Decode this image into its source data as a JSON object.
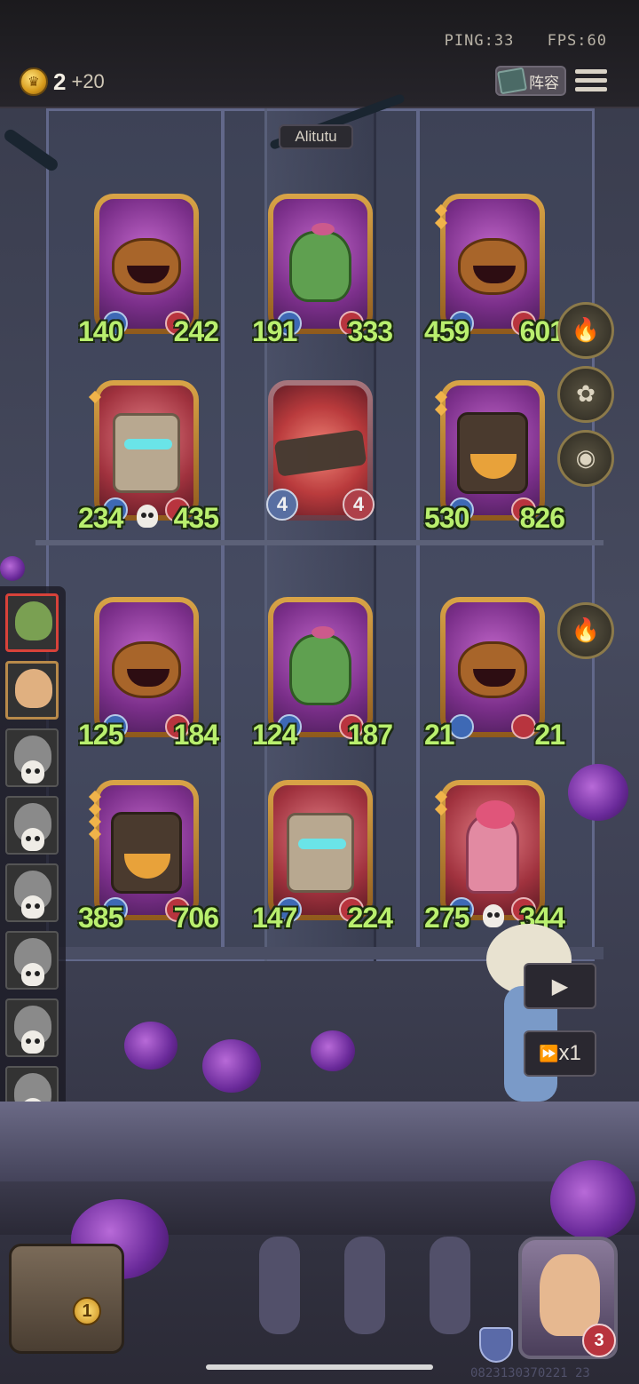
{
  "status": {
    "ping": "PING:33",
    "fps": "FPS:60"
  },
  "gold": {
    "amount": "2",
    "income": "+20"
  },
  "header": {
    "lineup_label": "阵容"
  },
  "opponent": {
    "name": "Alitutu"
  },
  "cards": [
    {
      "monster": "pumpkin",
      "atk": "140",
      "hp": "242",
      "stars": 0
    },
    {
      "monster": "cactus",
      "atk": "191",
      "hp": "333",
      "stars": 0
    },
    {
      "monster": "pumpkin",
      "atk": "459",
      "hp": "601",
      "stars": 2
    },
    {
      "monster": "tree",
      "atk": "234",
      "hp": "435",
      "stars": 1,
      "skull": true
    },
    {
      "monster": "ghost-cactus",
      "atk": "4",
      "hp": "4",
      "stars": 0,
      "ghost": true
    },
    {
      "monster": "stump",
      "atk": "530",
      "hp": "826",
      "stars": 2
    },
    {
      "monster": "pumpkin",
      "atk": "125",
      "hp": "184",
      "stars": 0
    },
    {
      "monster": "cactus",
      "atk": "124",
      "hp": "187",
      "stars": 0
    },
    {
      "monster": "pumpkin",
      "atk": "21",
      "hp": "21",
      "stars": 0
    },
    {
      "monster": "stump",
      "atk": "385",
      "hp": "706",
      "stars": 4
    },
    {
      "monster": "tree",
      "atk": "147",
      "hp": "224",
      "stars": 0
    },
    {
      "monster": "lady",
      "atk": "275",
      "hp": "344",
      "stars": 2,
      "skull": true
    }
  ],
  "items": [
    {
      "icon": "lighter-icon"
    },
    {
      "icon": "rose-icon"
    },
    {
      "icon": "crystal-orb-icon"
    },
    {
      "icon": "lighter-icon"
    }
  ],
  "roster": [
    {
      "state": "active"
    },
    {
      "state": "alive"
    },
    {
      "state": "dead"
    },
    {
      "state": "dead"
    },
    {
      "state": "dead"
    },
    {
      "state": "dead"
    },
    {
      "state": "dead"
    },
    {
      "state": "dead"
    }
  ],
  "controls": {
    "speed_label": "x1"
  },
  "chest": {
    "count": "1"
  },
  "hero": {
    "lives": "3"
  },
  "build_id": "0823130370221 23"
}
